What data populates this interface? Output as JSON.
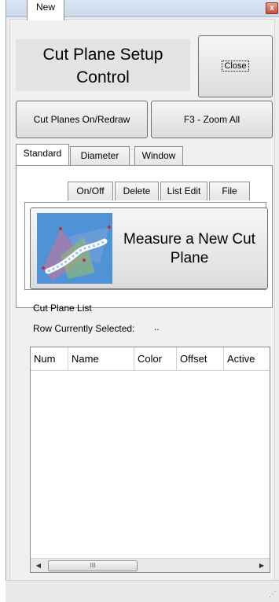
{
  "window": {
    "close_glyph": "x"
  },
  "header": {
    "title": "Cut Plane Setup Control",
    "close_label": "Close"
  },
  "toolbar": {
    "cut_planes_label": "Cut Planes On/Redraw",
    "zoom_all_label": "F3 - Zoom All"
  },
  "tabs": [
    "Standard",
    "Diameter",
    "Window"
  ],
  "subtabs": [
    "New",
    "On/Off",
    "Delete",
    "List Edit",
    "File"
  ],
  "measure": {
    "label": "Measure a New Cut Plane",
    "icon": "cut-plane-curve-icon"
  },
  "list": {
    "title": "Cut Plane List",
    "row_selected_label": "Row Currently Selected:",
    "row_selected_value": ".."
  },
  "grid": {
    "columns": [
      "Num",
      "Name",
      "Color",
      "Offset",
      "Active"
    ],
    "rows": [],
    "scroll_thumb_glyph": "III"
  },
  "colors": {
    "window_bg": "#f0f0f0",
    "titlebar": "#c9d8ea",
    "close_red": "#c74f3a"
  }
}
